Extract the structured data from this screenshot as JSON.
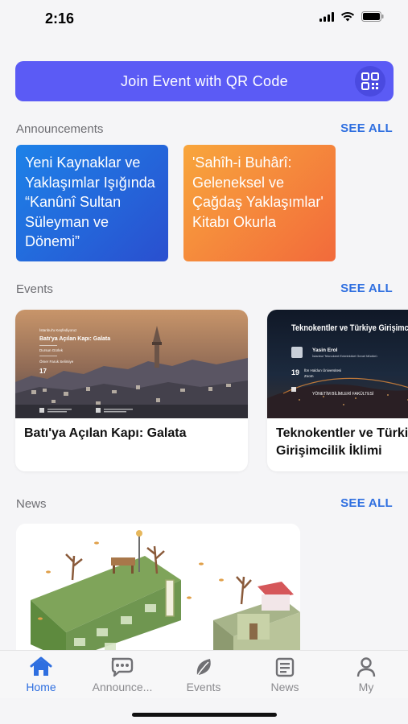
{
  "status": {
    "time": "2:16"
  },
  "qr_button": {
    "label": "Join Event with QR Code"
  },
  "announcements": {
    "title": "Announcements",
    "see_all": "SEE ALL",
    "items": [
      {
        "text": "Yeni Kaynaklar ve Yaklaşımlar Işığında “Kanûnî Sultan Süleyman ve Dönemi”"
      },
      {
        "text": "'Sahîh-i Buhârî: Geleneksel ve Çağdaş Yaklaşımlar' Kitabı Okurla"
      }
    ]
  },
  "events": {
    "title": "Events",
    "see_all": "SEE ALL",
    "items": [
      {
        "title": "Batı'ya Açılan Kapı: Galata",
        "poster": {
          "series": "İstanbul'u Keşfediyoruz",
          "heading": "Batı'ya Açılan Kapı: Galata",
          "speaker1": "Dursun Gürlek",
          "speaker2": "Ömer Faruk Selimiye",
          "day": "17"
        }
      },
      {
        "title": "Teknokentler ve Türkiye Girişimcilik İklimi",
        "poster": {
          "heading": "Teknokentler ve Türkiye Girişimcilik İklimi",
          "speaker": "Yasin Erol",
          "speaker_role": "İstanbul Teknokent Entelektüel Genel Müdürü",
          "day": "19",
          "venue": "İbn Haldun Üniversitesi",
          "platform": "Zoom",
          "faculty": "YÖNETİM BİLİMLERİ FAKÜLTESİ"
        }
      }
    ]
  },
  "news": {
    "title": "News",
    "see_all": "SEE ALL"
  },
  "tabs": [
    {
      "label": "Home",
      "icon": "home-icon",
      "active": true
    },
    {
      "label": "Announce...",
      "icon": "chat-icon",
      "active": false
    },
    {
      "label": "Events",
      "icon": "leaf-icon",
      "active": false
    },
    {
      "label": "News",
      "icon": "newspaper-icon",
      "active": false
    },
    {
      "label": "My",
      "icon": "person-icon",
      "active": false
    }
  ],
  "colors": {
    "accent": "#2f6fe0",
    "qr_button": "#5b5bf5",
    "announcement_blue": "#1d82e8",
    "announcement_orange": "#f58a3c"
  }
}
